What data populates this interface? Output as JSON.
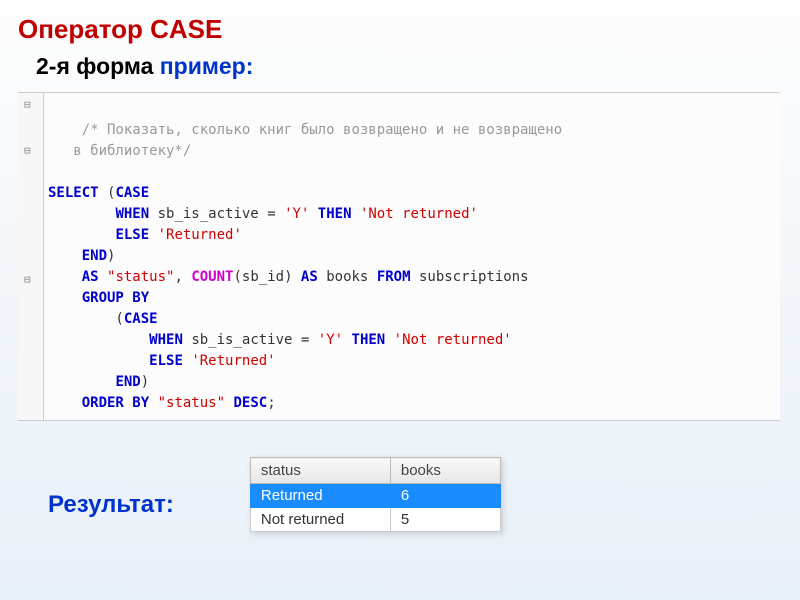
{
  "title": "Оператор CASE",
  "subtitle_black": "2-я форма ",
  "subtitle_blue": "пример:",
  "code": {
    "comment1": "/* Показать, сколько книг было возвращено и не возвращено",
    "comment2": "   в библиотеку*/",
    "select": "SELECT",
    "case": "CASE",
    "when": "WHEN",
    "then": "THEN",
    "else": "ELSE",
    "end": "END",
    "as": "AS",
    "from": "FROM",
    "group_by": "GROUP BY",
    "order_by": "ORDER BY",
    "desc": "DESC",
    "count": "COUNT",
    "col_active": "sb_is_active",
    "val_y": "'Y'",
    "val_notret": "'Not returned'",
    "val_ret": "'Returned'",
    "alias_status": "\"status\"",
    "col_id": "sb_id",
    "alias_books": "books",
    "table": "subscriptions"
  },
  "result_label": "Результат:",
  "table": {
    "headers": [
      "status",
      "books"
    ],
    "rows": [
      {
        "status": "Returned",
        "books": "6",
        "selected": true
      },
      {
        "status": "Not returned",
        "books": "5",
        "selected": false
      }
    ]
  },
  "chart_data": {
    "type": "table",
    "title": "Результат",
    "columns": [
      "status",
      "books"
    ],
    "rows": [
      [
        "Returned",
        6
      ],
      [
        "Not returned",
        5
      ]
    ]
  }
}
